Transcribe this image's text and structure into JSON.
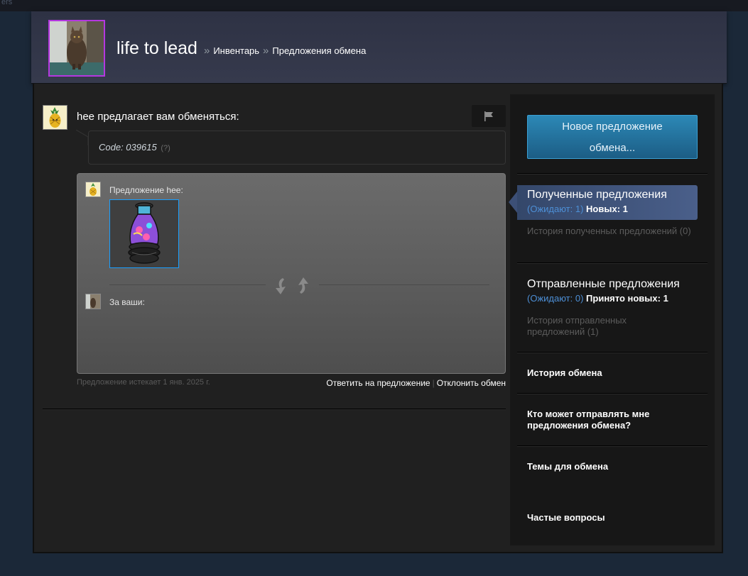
{
  "topbar": {
    "text": "ers"
  },
  "header": {
    "persona_name": "life to lead",
    "breadcrumb": [
      {
        "label": "Инвентарь"
      },
      {
        "label": "Предложения обмена"
      }
    ],
    "separator": "»"
  },
  "offer": {
    "title": "hee предлагает вам обменяться:",
    "message": "Code: 039615",
    "message_help": "(?)",
    "partner_offer_label": "Предложение hee:",
    "your_offer_label": "За ваши:",
    "expires_text": "Предложение истекает 1 янв. 2025 г.",
    "respond_label": "Ответить на предложение",
    "decline_label": "Отклонить обмен",
    "actions_separator": "|"
  },
  "sidebar": {
    "new_offer_label_line1": "Новое предложение",
    "new_offer_label_line2": "обмена...",
    "received": {
      "title": "Полученные предложения",
      "pending": "(Ожидают: 1)",
      "new_label": "Новых: 1",
      "history": "История полученных предложений (0)"
    },
    "sent": {
      "title": "Отправленные предложения",
      "pending": "(Ожидают: 0)",
      "accepted_label": "Принято новых: 1",
      "history": "История отправленных предложений (1)"
    },
    "trade_history": "История обмена",
    "who_can_send": "Кто может отправлять мне предложения обмена?",
    "trade_topics": "Темы для обмена",
    "faq": "Частые вопросы"
  },
  "colors": {
    "page_bg": "#1b2838",
    "panel_bg": "#202020",
    "accent_blue": "#4d8fd6",
    "active_tab": "#4a5f8a",
    "item_border": "#1a9fff"
  },
  "icons": {
    "flag": "flag-icon",
    "trade_arrows": "trade-arrows-icon"
  }
}
